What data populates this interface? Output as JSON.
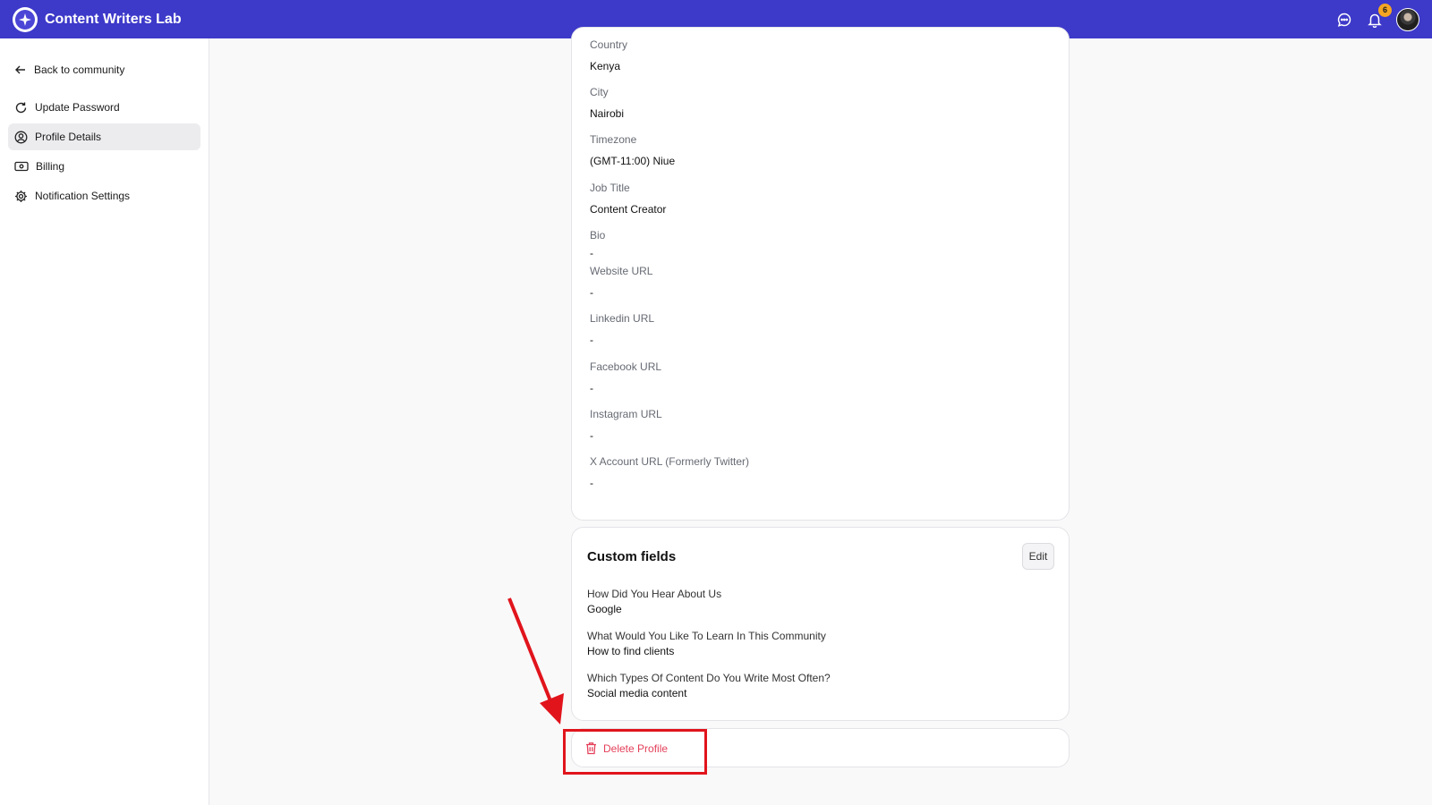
{
  "app": {
    "title": "Content Writers Lab"
  },
  "header": {
    "notification_count": "6"
  },
  "sidebar": {
    "back_label": "Back to community",
    "items": [
      {
        "label": "Update Password",
        "icon": "refresh-icon"
      },
      {
        "label": "Profile Details",
        "icon": "user-circle-icon",
        "active": true
      },
      {
        "label": "Billing",
        "icon": "billing-icon"
      },
      {
        "label": "Notification Settings",
        "icon": "gear-icon"
      }
    ]
  },
  "profile": {
    "fields": [
      {
        "label": "Country",
        "value": "Kenya"
      },
      {
        "label": "City",
        "value": "Nairobi"
      },
      {
        "label": "Timezone",
        "value": "(GMT-11:00) Niue"
      },
      {
        "label": "Job Title",
        "value": "Content Creator"
      },
      {
        "label": "Bio",
        "value": "-"
      },
      {
        "label": "Website URL",
        "value": "-"
      },
      {
        "label": "Linkedin URL",
        "value": "-"
      },
      {
        "label": "Facebook URL",
        "value": "-"
      },
      {
        "label": "Instagram URL",
        "value": "-"
      },
      {
        "label": "X Account URL (Formerly Twitter)",
        "value": "-"
      }
    ]
  },
  "custom_fields": {
    "title": "Custom fields",
    "edit_label": "Edit",
    "items": [
      {
        "question": "How Did You Hear About Us",
        "answer": "Google"
      },
      {
        "question": "What Would You Like To Learn In This Community",
        "answer": "How to find clients"
      },
      {
        "question": "Which Types Of Content Do You Write Most Often?",
        "answer": "Social media content"
      }
    ]
  },
  "danger": {
    "delete_label": "Delete Profile"
  },
  "colors": {
    "brand": "#3d39c9",
    "danger": "#e4405a",
    "annotation": "#e1141c",
    "badge": "#f5a623"
  }
}
